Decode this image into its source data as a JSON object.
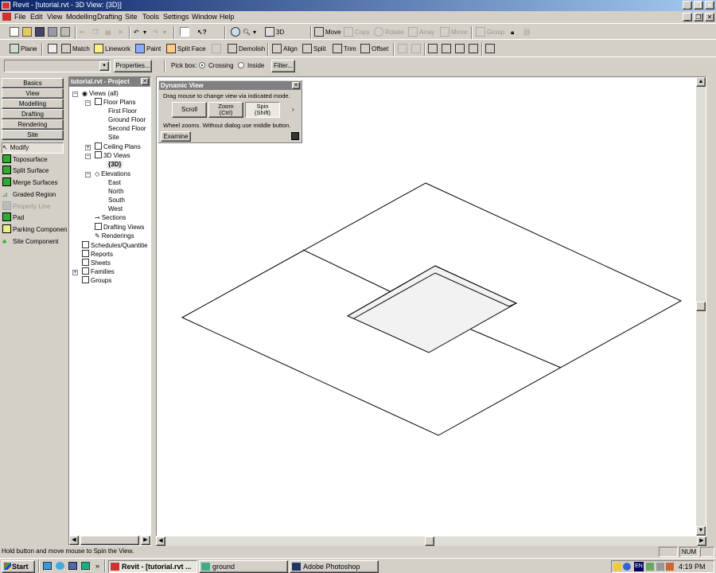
{
  "window": {
    "title": "Revit - [tutorial.rvt - 3D View: {3D}]",
    "controls": [
      "_",
      "❐",
      "✕"
    ]
  },
  "menu": [
    "File",
    "Edit",
    "View",
    "Modelling",
    "Drafting",
    "Site",
    "Tools",
    "Settings",
    "Window",
    "Help"
  ],
  "toolbar1": {
    "view_3d": "3D",
    "move": "Move",
    "copy": "Copy",
    "rotate": "Rotate",
    "array": "Array",
    "mirror": "Mirror",
    "group": "Group"
  },
  "toolbar2": {
    "plane": "Plane",
    "match": "Match",
    "linework": "Linework",
    "paint": "Paint",
    "split_face": "Split Face",
    "demolish": "Demolish",
    "align": "Align",
    "split": "Split",
    "trim": "Trim",
    "offset": "Offset"
  },
  "optionsbar": {
    "properties": "Properties...",
    "pick_box": "Pick box:",
    "crossing": "Crossing",
    "inside": "Inside",
    "filter": "Filter..."
  },
  "designbar": {
    "tabs": [
      "Basics",
      "View",
      "Modelling",
      "Drafting",
      "Rendering",
      "Site"
    ],
    "tools": [
      "Modify",
      "Toposurface",
      "Split Surface",
      "Merge Surfaces",
      "Graded Region",
      "Property Line",
      "Pad",
      "Parking Componen",
      "Site Component"
    ]
  },
  "browser": {
    "title": "tutorial.rvt - Project",
    "nodes": [
      "Views (all)",
      "Floor Plans",
      "First Floor",
      "Ground Floor",
      "Second Floor",
      "Site",
      "Ceiling Plans",
      "3D Views",
      "{3D}",
      "Elevations",
      "East",
      "North",
      "South",
      "West",
      "Sections",
      "Drafting Views",
      "Renderings",
      "Schedules/Quantitie",
      "Reports",
      "Sheets",
      "Families",
      "Groups"
    ]
  },
  "dynamic_view": {
    "title": "Dynamic View",
    "instruction": "Drag mouse to change view via indicated mode.",
    "scroll": "Scroll",
    "zoom": "Zoom",
    "zoom_key": "(Ctrl)",
    "spin": "Spin",
    "spin_key": "(Shift)",
    "hint": "Wheel zooms.  Without dialog use middle button.",
    "examine": "Examine"
  },
  "status": {
    "message": "Hold button and move mouse to Spin the View.",
    "num": "NUM"
  },
  "taskbar": {
    "start": "Start",
    "tasks": [
      "Revit - [tutorial.rvt ...",
      "ground",
      "Adobe Photoshop"
    ],
    "lang": "EN",
    "clock": "4:19 PM"
  }
}
